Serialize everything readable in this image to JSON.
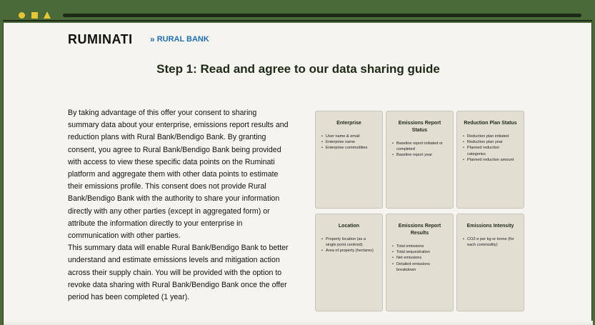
{
  "brand": {
    "ruminati": "RUMINATI",
    "rural_bank": "RURAL BANK"
  },
  "title": "Step 1: Read and agree to our data sharing guide",
  "paragraphs": [
    "By taking advantage of this offer your consent to sharing summary data about your enterprise, emissions report results and reduction plans with Rural Bank/Bendigo Bank. By granting consent, you agree to Rural Bank/Bendigo Bank being provided with access to view these specific data points on the Ruminati platform and aggregate them with other data points to estimate their emissions profile. This consent does not provide Rural Bank/Bendigo Bank with the authority to share your information directly with any other parties (except in aggregated form) or attribute the information directly to your enterprise in communication with other parties.",
    "This summary data will enable Rural Bank/Bendigo Bank to better understand and estimate emissions levels and mitigation action across their supply chain. You will be provided with the option to revoke data sharing with Rural Bank/Bendigo Bank once the offer period has been completed (1 year)."
  ],
  "cards": [
    {
      "title": "Enterprise",
      "items": [
        "User name & email",
        "Enterprise name",
        "Enterprise commodities"
      ]
    },
    {
      "title": "Emissions Report Status",
      "items": [
        "Baseline report initiated or completed",
        "Baseline report year"
      ]
    },
    {
      "title": "Reduction Plan Status",
      "items": [
        "Reduction plan initiated",
        "Reduction plan year",
        "Planned reduction categories",
        "Planned reduction amount"
      ]
    },
    {
      "title": "Location",
      "items": [
        "Property location (as a single point centroid)",
        "Area of property (hectares)"
      ]
    },
    {
      "title": "Emissions Report Results",
      "items": [
        "Total emissions",
        "Total sequestration",
        "Net emissions",
        "Detailed emissions breakdown"
      ]
    },
    {
      "title": "Emissions Intensity",
      "items": [
        "CO2-e per kg or tonne (for each commodity)"
      ]
    }
  ],
  "colors": {
    "frame": "#4a6a3a",
    "accent": "#e6c633",
    "rural_bank_blue": "#1f6fb5",
    "card_bg": "#e3ded2"
  }
}
